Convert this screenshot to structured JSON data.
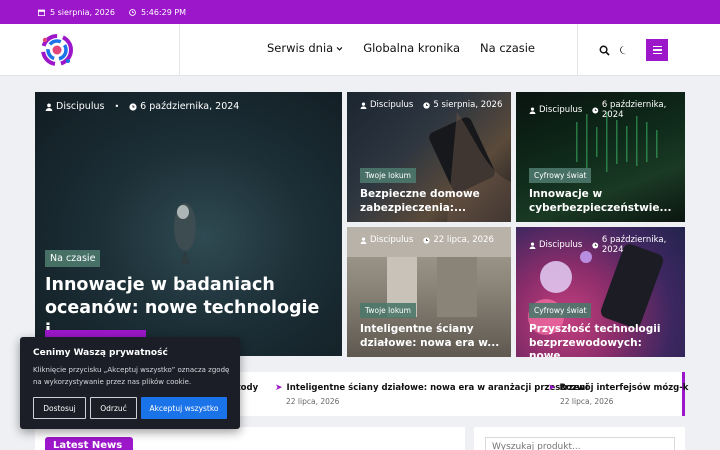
{
  "topbar": {
    "date": "5 sierpnia, 2026",
    "time": "5:46:29 PM"
  },
  "nav": {
    "items": [
      "Serwis dnia",
      "Globalna kronika",
      "Na czasie"
    ]
  },
  "colors": {
    "accent": "#9c17c9",
    "tag_bg": "#4c786c",
    "cookie_bg": "#1b1e27",
    "accept_btn": "#1a73e8"
  },
  "icons": {
    "date": "calendar-icon",
    "time": "clock-icon",
    "search": "search-icon",
    "theme": "moon-icon",
    "menu": "hamburger-menu-icon",
    "author": "user-icon"
  },
  "featured": {
    "author": "Discipulus",
    "date": "6 października, 2024",
    "tag": "Na czasie",
    "title": "Innowacje w badaniach oceanów: nowe technologie i..."
  },
  "cards": [
    {
      "author": "Discipulus",
      "date": "5 sierpnia, 2026",
      "tag": "Twoje lokum",
      "title": "Bezpieczne domowe zabezpieczenia:..."
    },
    {
      "author": "Discipulus",
      "date": "6 października, 2024",
      "tag": "Cyfrowy świat",
      "title": "Innowacje w cyberbezpieczeństwie..."
    },
    {
      "author": "Discipulus",
      "date": "22 lipca, 2026",
      "tag": "Twoje lokum",
      "title": "Inteligentne ściany działowe: nowa era w..."
    },
    {
      "author": "Discipulus",
      "date": "6 października, 2024",
      "tag": "Cyfrowy świat",
      "title": "Przyszłość technologii bezprzewodowych: nowe..."
    }
  ],
  "ticker": [
    {
      "title": "metody"
    },
    {
      "title": "Inteligentne ściany działowe: nowa era w aranżacji przestrzeni",
      "date": "22 lipca, 2026"
    },
    {
      "title": "Rozwój interfejsów mózg-k",
      "date": "22 lipca, 2026"
    }
  ],
  "latest": {
    "label": "Latest News"
  },
  "search": {
    "placeholder": "Wyszukaj produkt..."
  },
  "cookie": {
    "title": "Cenimy Waszą prywatność",
    "text": "Kliknięcie przycisku „Akceptuj wszystko” oznacza zgodę na wykorzystywanie przez nas plików cookie.",
    "customize": "Dostosuj",
    "reject": "Odrzuć",
    "accept": "Akceptuj wszystko"
  }
}
